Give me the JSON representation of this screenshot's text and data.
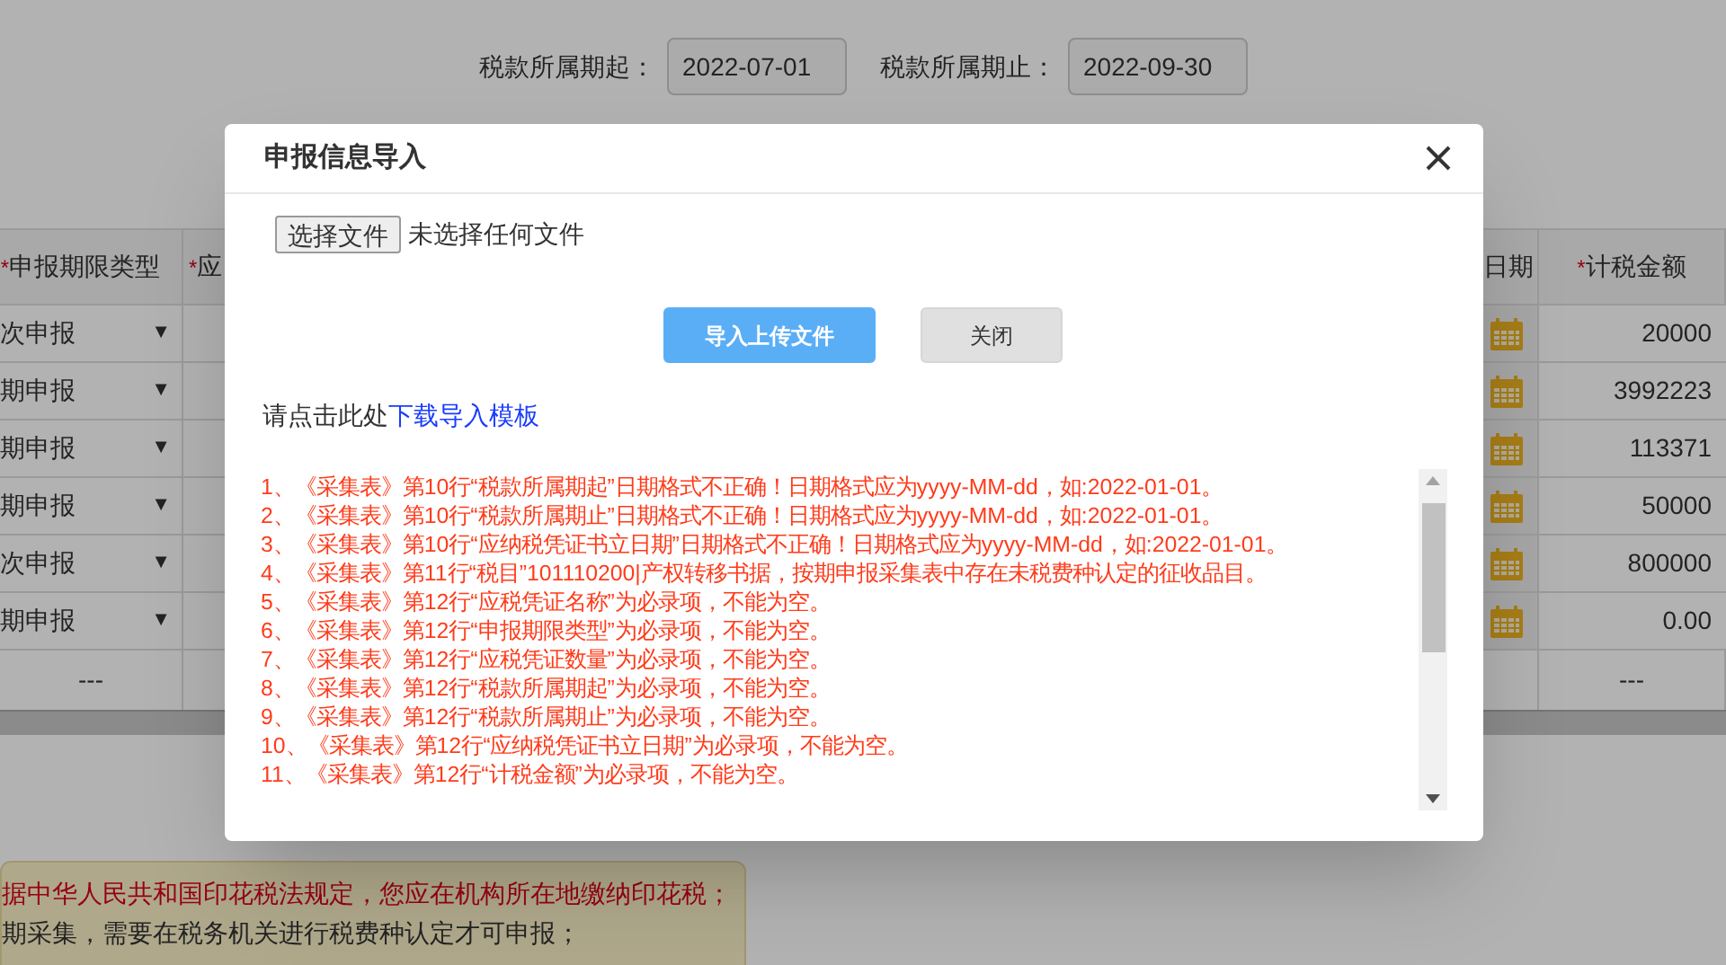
{
  "filters": [
    {
      "label": "税款所属期起：",
      "value": "2022-07-01"
    },
    {
      "label": "税款所属期止：",
      "value": "2022-09-30"
    }
  ],
  "table": {
    "columns": [
      {
        "label": "申报期限类型",
        "marker": "*"
      },
      {
        "label": "应",
        "marker": "*"
      },
      {
        "label": "日期"
      },
      {
        "label": "计税金额",
        "marker": "*"
      }
    ],
    "rows": [
      {
        "period_type": "次申报",
        "arrow": "▼",
        "amount": "20000"
      },
      {
        "period_type": "期申报",
        "arrow": "▼",
        "amount": "3992223"
      },
      {
        "period_type": "期申报",
        "arrow": "▼",
        "amount": "113371"
      },
      {
        "period_type": "期申报",
        "arrow": "▼",
        "amount": "50000"
      },
      {
        "period_type": "次申报",
        "arrow": "▼",
        "amount": "800000"
      },
      {
        "period_type": "期申报",
        "arrow": "▼",
        "amount": "0.00"
      }
    ],
    "footer": {
      "column_1": "---",
      "column_4": "---"
    }
  },
  "notice": {
    "lines": [
      {
        "text": "据中华人民共和国印花税法规定，您应在机构所在地缴纳印花税；",
        "kind": "warning"
      },
      {
        "text": "期采集，需要在税务机关进行税费种认定才可申报；",
        "kind": "plain"
      }
    ]
  },
  "dialog": {
    "title": "申报信息导入",
    "file_button": "选择文件",
    "file_status": "未选择任何文件",
    "buttons": [
      {
        "label": "导入上传文件",
        "kind": "primary"
      },
      {
        "label": "关闭",
        "kind": "secondary"
      }
    ],
    "template_hint": {
      "text": "请点击此处",
      "link": "下载导入模板"
    },
    "errors": [
      "1、《采集表》第10行“税款所属期起”日期格式不正确！日期格式应为yyyy-MM-dd，如:2022-01-01。",
      "2、《采集表》第10行“税款所属期止”日期格式不正确！日期格式应为yyyy-MM-dd，如:2022-01-01。",
      "3、《采集表》第10行“应纳税凭证书立日期”日期格式不正确！日期格式应为yyyy-MM-dd，如:2022-01-01。",
      "4、《采集表》第11行“税目”101110200|产权转移书据，按期申报采集表中存在未税费种认定的征收品目。",
      "5、《采集表》第12行“应税凭证名称”为必录项，不能为空。",
      "6、《采集表》第12行“申报期限类型”为必录项，不能为空。",
      "7、《采集表》第12行“应税凭证数量”为必录项，不能为空。",
      "8、《采集表》第12行“税款所属期起”为必录项，不能为空。",
      "9、《采集表》第12行“税款所属期止”为必录项，不能为空。",
      "10、《采集表》第12行“应纳税凭证书立日期”为必录项，不能为空。",
      "11、《采集表》第12行“计税金额”为必录项，不能为空。"
    ]
  }
}
